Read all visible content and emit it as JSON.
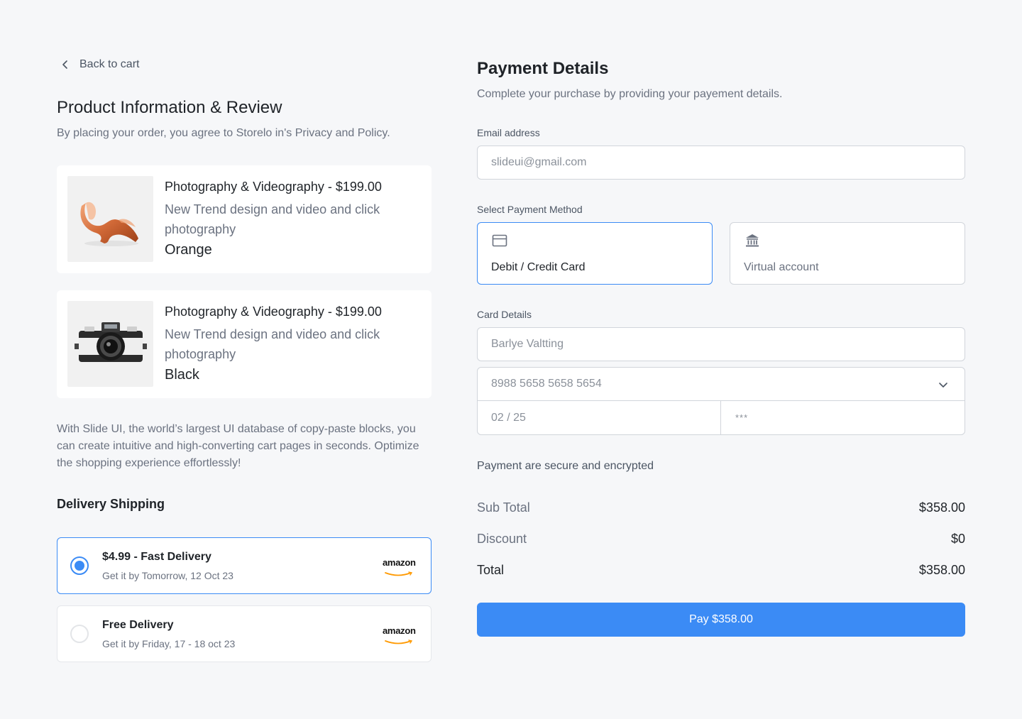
{
  "back_link": {
    "label": "Back to cart"
  },
  "review": {
    "title": "Product Information & Review",
    "agreement": "By placing your order, you agree to Storelo in's Privacy and Policy.",
    "products": [
      {
        "title": "Photography & Videography - $199.00",
        "description": "New Trend design and video and click photography",
        "color": "Orange",
        "image": "orange-chair"
      },
      {
        "title": "Photography & Videography - $199.00",
        "description": "New Trend design and video and click photography",
        "color": "Black",
        "image": "vintage-camera"
      }
    ],
    "blurb": "With Slide UI, the world’s largest UI database of copy-paste blocks, you can create intuitive and high-converting cart pages in seconds. Optimize the shopping experience effortlessly!"
  },
  "delivery": {
    "title": "Delivery Shipping",
    "options": [
      {
        "name": "$4.99 - Fast Delivery",
        "eta": "Get it by Tomorrow, 12 Oct 23",
        "carrier": "amazon",
        "selected": true
      },
      {
        "name": "Free Delivery",
        "eta": "Get it by Friday, 17 - 18 oct 23",
        "carrier": "amazon",
        "selected": false
      }
    ]
  },
  "payment": {
    "title": "Payment Details",
    "subtitle": "Complete your purchase by providing your payement details.",
    "email_label": "Email address",
    "email_placeholder": "slideui@gmail.com",
    "method_label": "Select Payment Method",
    "methods": [
      {
        "label": "Debit / Credit Card",
        "icon": "credit-card-icon",
        "selected": true
      },
      {
        "label": "Virtual account",
        "icon": "bank-icon",
        "selected": false
      }
    ],
    "card_label": "Card Details",
    "card_name": "Barlye Valtting",
    "card_number": "8988 5658 5658 5654",
    "card_expiry": "02 / 25",
    "card_cvc": "***",
    "secure_note": "Payment are secure and encrypted",
    "summary": [
      {
        "label": "Sub Total",
        "value": "$358.00"
      },
      {
        "label": "Discount",
        "value": "$0"
      },
      {
        "label": "Total",
        "value": "$358.00"
      }
    ],
    "pay_button": "Pay $358.00"
  },
  "colors": {
    "accent": "#3b8bf5",
    "background": "#f6f7f9"
  }
}
